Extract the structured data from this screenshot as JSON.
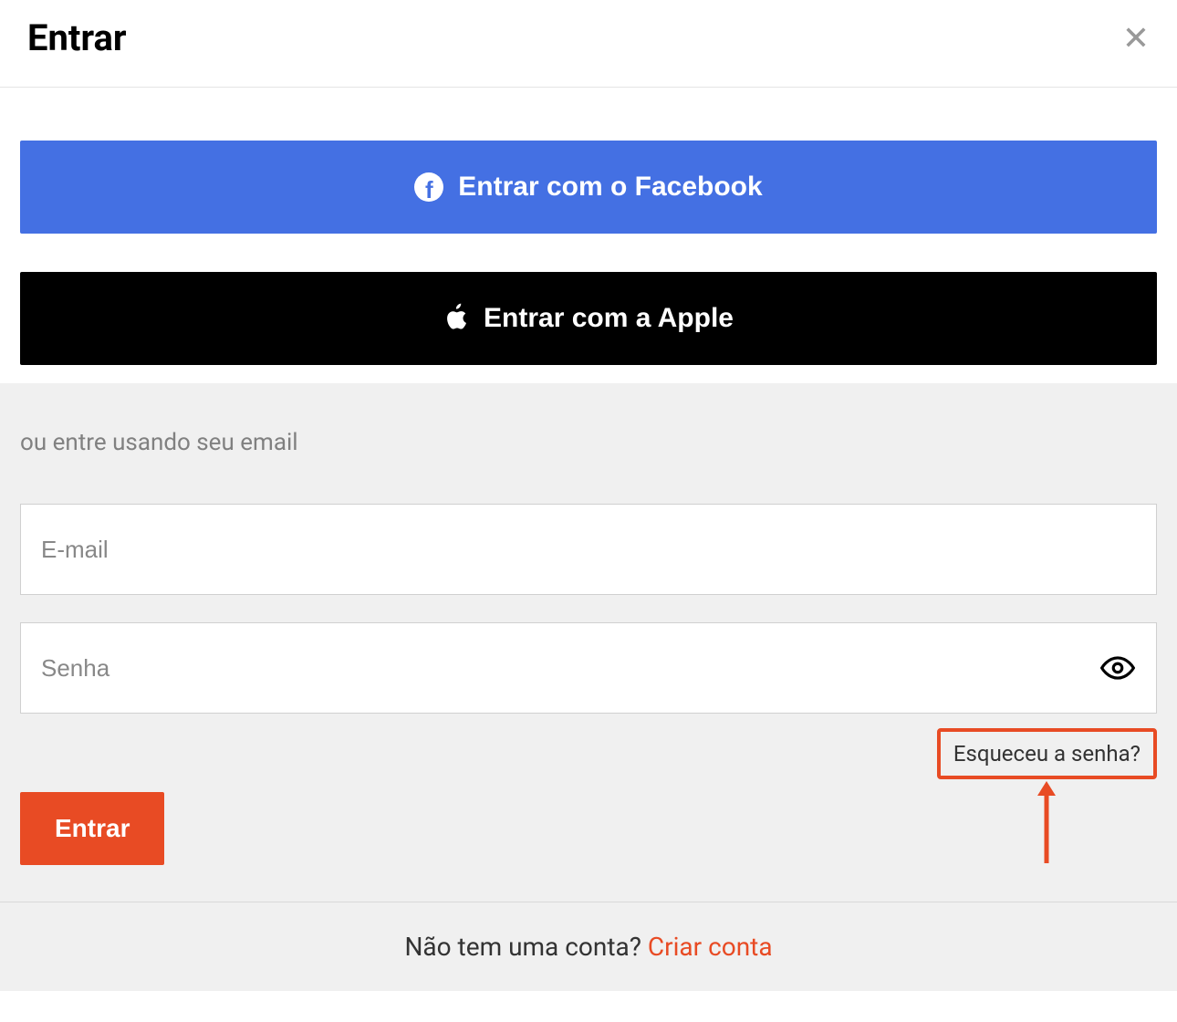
{
  "header": {
    "title": "Entrar"
  },
  "social": {
    "facebook_label": "Entrar com o Facebook",
    "apple_label": "Entrar com a Apple"
  },
  "form": {
    "subtitle": "ou entre usando seu email",
    "email_placeholder": "E-mail",
    "password_placeholder": "Senha",
    "forgot_label": "Esqueceu a senha?",
    "submit_label": "Entrar"
  },
  "footer": {
    "no_account_text": "Não tem uma conta? ",
    "create_label": "Criar conta"
  },
  "colors": {
    "facebook": "#4470e3",
    "apple": "#000000",
    "accent": "#e84b24"
  }
}
